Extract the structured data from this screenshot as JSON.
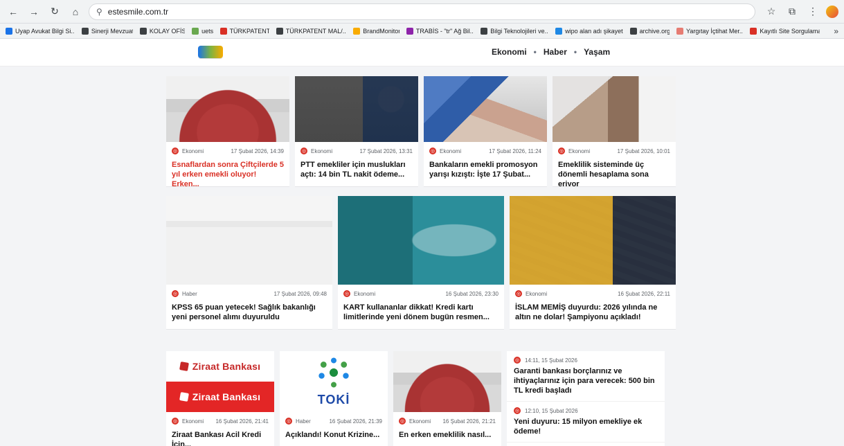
{
  "browser": {
    "url": "estesmile.com.tr",
    "icons": [
      "back-arrow-icon",
      "forward-arrow-icon",
      "reload-icon",
      "home-icon",
      "site-info-icon",
      "star-icon",
      "extensions-icon",
      "menu-icon"
    ]
  },
  "bookmarks": [
    {
      "label": "Uyap Avukat Bilgi Si...",
      "color": "#1a73e8"
    },
    {
      "label": "Sinerji Mevzuat",
      "color": "#3c4043"
    },
    {
      "label": "KOLAY OFİS",
      "color": "#3c4043"
    },
    {
      "label": "uets",
      "color": "#6aa84f"
    },
    {
      "label": "TÜRKPATENT",
      "color": "#d93025"
    },
    {
      "label": "TÜRKPATENT MAL/...",
      "color": "#3c4043"
    },
    {
      "label": "BrandMonitor",
      "color": "#f9ab00"
    },
    {
      "label": "TRABİS - \"tr\" Ağ Bil...",
      "color": "#8e24aa"
    },
    {
      "label": "Bilgi Teknolojileri ve...",
      "color": "#3c4043"
    },
    {
      "label": "wipo alan adı şikayeti",
      "color": "#1e88e5"
    },
    {
      "label": "archive.org",
      "color": "#3c4043"
    },
    {
      "label": "Yargıtay İçtihat Mer...",
      "color": "#e67c73"
    },
    {
      "label": "Kayıtlı Site Sorgulama",
      "color": "#d93025"
    }
  ],
  "header": {
    "nav": [
      "Ekonomi",
      "Haber",
      "Yaşam"
    ],
    "nav_sep": "•"
  },
  "cards_row1": [
    {
      "cat": "Ekonomi",
      "date": "17 Şubat 2026, 14:39",
      "title": "Esnaflardan sonra Çiftçilerde 5 yıl erken emekli oluyor! Erken...",
      "title_color": "#d93025",
      "img": "parliament"
    },
    {
      "cat": "Ekonomi",
      "date": "17 Şubat 2026, 13:31",
      "title": "PTT emekliler için muslukları açtı: 14 bin TL nakit ödeme...",
      "title_color": "#111111",
      "img": "atm"
    },
    {
      "cat": "Ekonomi",
      "date": "17 Şubat 2026, 11:24",
      "title": "Bankaların emekli promosyon yarışı kızıştı: İşte 17 Şubat...",
      "title_color": "#111111",
      "img": "money"
    },
    {
      "cat": "Ekonomi",
      "date": "17 Şubat 2026, 10:01",
      "title": "Emeklilik sisteminde üç dönemli hesaplama sona eriyor",
      "title_color": "#111111",
      "img": "cash-hands"
    }
  ],
  "cards_row2": [
    {
      "cat": "Haber",
      "date": "17 Şubat 2026, 09:48",
      "title": "KPSS 65 puan yetecek! Sağlık bakanlığı yeni personel alımı duyuruldu",
      "img": "ministry"
    },
    {
      "cat": "Ekonomi",
      "date": "16 Şubat 2026, 23:30",
      "title": "KART kullananlar dikkat! Kredi kartı limitlerinde yeni dönem bugün resmen...",
      "img": "card-phone"
    },
    {
      "cat": "Ekonomi",
      "date": "16 Şubat 2026, 22:11",
      "title": "İSLAM MEMİŞ duyurdu: 2026 yılında ne altın ne dolar! Şampiyonu açıkladı!",
      "img": "gold-man"
    }
  ],
  "cards_row3": [
    {
      "cat": "Ekonomi",
      "date": "16 Şubat 2026, 21:41",
      "title": "Ziraat Bankası Acil Kredi İçin...",
      "img": "ziraat"
    },
    {
      "cat": "Haber",
      "date": "16 Şubat 2026, 21:39",
      "title": "Açıklandı! Konut Krizine...",
      "img": "toki"
    },
    {
      "cat": "Ekonomi",
      "date": "16 Şubat 2026, 21:21",
      "title": "En erken emeklilik nasıl...",
      "img": "parliament"
    }
  ],
  "right_list": [
    {
      "time": "14:11, 15 Şubat 2026",
      "title": "Garanti bankası borçlarınız ve ihtiyaçlarınız için para verecek: 500 bin TL kredi başladı"
    },
    {
      "time": "12:10, 15 Şubat 2026",
      "title": "Yeni duyuru: 15 milyon emekliye ek ödeme!"
    }
  ],
  "logos": {
    "ziraat_text": "Ziraat Bankası",
    "toki_text": "TOKİ"
  }
}
